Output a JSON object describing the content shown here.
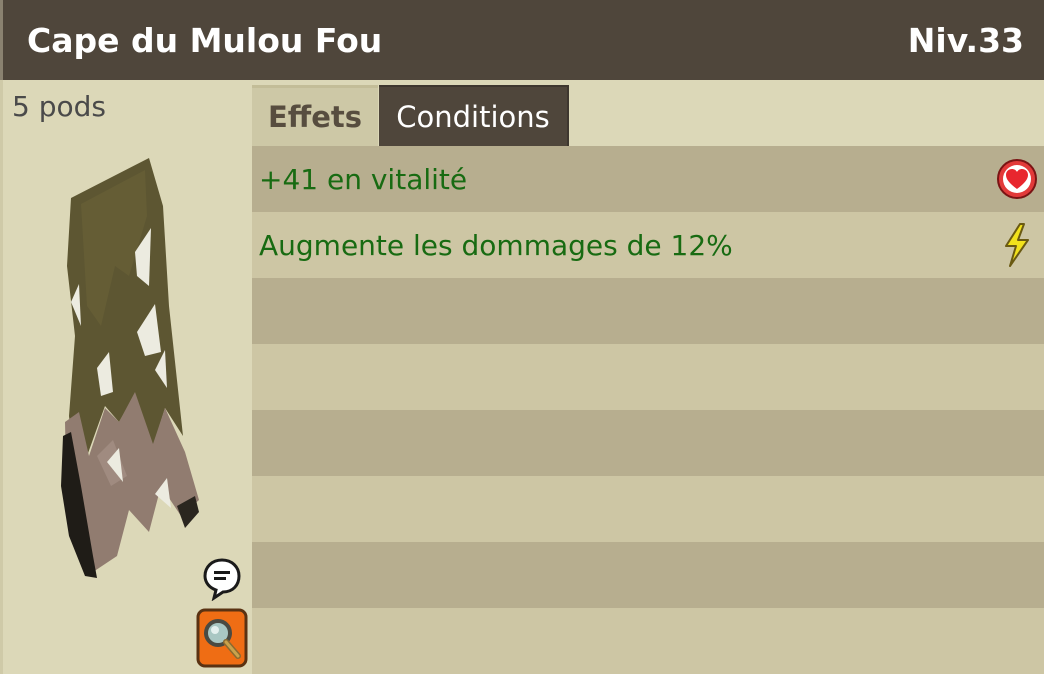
{
  "header": {
    "item_name": "Cape du Mulou Fou",
    "level": "Niv.33"
  },
  "left_panel": {
    "weight": "5 pods",
    "item_image_icon": "torn-cape-icon",
    "chat_icon": "speech-bubble-icon",
    "inspect_icon": "magnifier-icon"
  },
  "tabs": [
    {
      "label": "Effets",
      "active": true
    },
    {
      "label": "Conditions",
      "active": false
    }
  ],
  "effects": [
    {
      "text": "+41 en vitalité",
      "icon": "heart-icon"
    },
    {
      "text": "Augmente les dommages de 12%",
      "icon": "lightning-icon"
    },
    {
      "text": "",
      "icon": ""
    },
    {
      "text": "",
      "icon": ""
    },
    {
      "text": "",
      "icon": ""
    },
    {
      "text": "",
      "icon": ""
    },
    {
      "text": "",
      "icon": ""
    },
    {
      "text": "",
      "icon": ""
    }
  ],
  "colors": {
    "header_bg": "#4f463b",
    "panel_bg": "#dcd8b8",
    "row_dark": "#b7ae8f",
    "row_light": "#cdc6a4",
    "effect_text": "#186b12"
  }
}
